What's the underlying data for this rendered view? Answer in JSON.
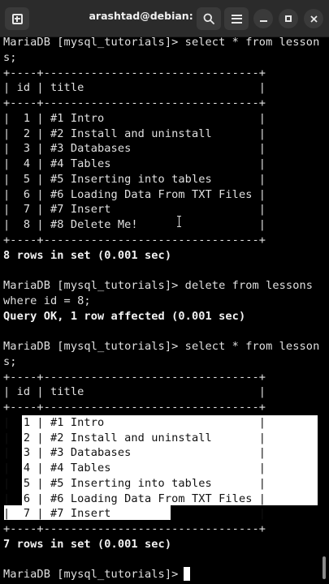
{
  "window": {
    "title": "arashtad@debian: ~"
  },
  "terminal": {
    "lines": [
      "MariaDB [mysql_tutorials]> select * from lesson",
      "s;",
      "+----+--------------------------------+",
      "| id | title                          |",
      "+----+--------------------------------+",
      "|  1 | #1 Intro                       |",
      "|  2 | #2 Install and uninstall       |",
      "|  3 | #3 Databases                   |",
      "|  4 | #4 Tables                      |",
      "|  5 | #5 Inserting into tables       |",
      "|  6 | #6 Loading Data From TXT Files |",
      "|  7 | #7 Insert                      |",
      "|  8 | #8 Delete Me!                  |",
      "+----+--------------------------------+",
      "8 rows in set (0.001 sec)",
      "",
      "MariaDB [mysql_tutorials]> delete from lessons",
      "where id = 8;",
      "Query OK, 1 row affected (0.001 sec)",
      "",
      "MariaDB [mysql_tutorials]> select * from lesson",
      "s;",
      "+----+--------------------------------+",
      "| id | title                          |",
      "+----+--------------------------------+",
      "|  1 | #1 Intro                       |",
      "|  2 | #2 Install and uninstall       |",
      "|  3 | #3 Databases                   |",
      "|  4 | #4 Tables                      |",
      "|  5 | #5 Inserting into tables       |",
      "|  6 | #6 Loading Data From TXT Files |",
      "|  7 | #7 Insert                      |",
      "+----+--------------------------------+",
      "7 rows in set (0.001 sec)",
      "",
      "MariaDB [mysql_tutorials]> "
    ],
    "bold_lines": [
      14,
      18,
      33
    ]
  }
}
